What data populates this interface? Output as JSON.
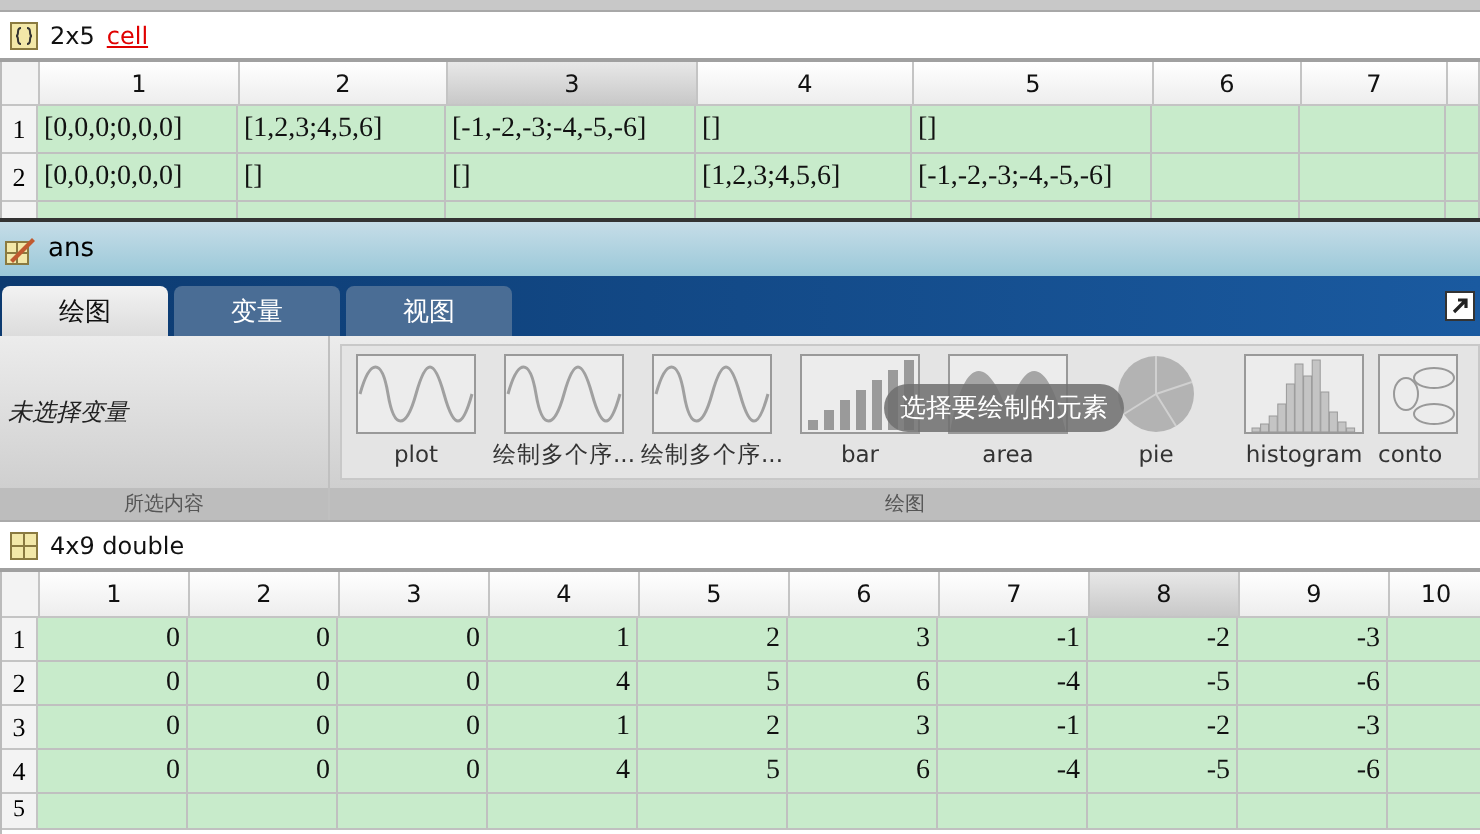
{
  "cell_view": {
    "size": "2x5",
    "type": "cell",
    "columns": [
      {
        "label": "1",
        "selected": false
      },
      {
        "label": "2",
        "selected": false
      },
      {
        "label": "3",
        "selected": true
      },
      {
        "label": "4",
        "selected": false
      },
      {
        "label": "5",
        "selected": false
      },
      {
        "label": "6",
        "selected": false
      },
      {
        "label": "7",
        "selected": false
      }
    ],
    "rows": [
      {
        "label": "1",
        "cells": [
          "[0,0,0;0,0,0]",
          "[1,2,3;4,5,6]",
          "[-1,-2,-3;-4,-5,-6]",
          "[]",
          "[]"
        ]
      },
      {
        "label": "2",
        "cells": [
          "[0,0,0;0,0,0]",
          "[]",
          "[]",
          "[1,2,3;4,5,6]",
          "[-1,-2,-3;-4,-5,-6]"
        ]
      }
    ]
  },
  "variable_bar": {
    "title": "ans"
  },
  "tabs": [
    {
      "label": "绘图",
      "selected": true
    },
    {
      "label": "变量",
      "selected": false
    },
    {
      "label": "视图",
      "selected": false
    }
  ],
  "ribbon": {
    "selection_text": "未选择变量",
    "selection_label": "所选内容",
    "gallery_label": "绘图",
    "tooltip": "选择要绘制的元素",
    "gallery": [
      {
        "label": "plot",
        "kind": "line"
      },
      {
        "label": "绘制多个序...",
        "kind": "line"
      },
      {
        "label": "绘制多个序...",
        "kind": "line"
      },
      {
        "label": "bar",
        "kind": "bar"
      },
      {
        "label": "area",
        "kind": "area"
      },
      {
        "label": "pie",
        "kind": "pie"
      },
      {
        "label": "histogram",
        "kind": "histogram"
      },
      {
        "label": "conto",
        "kind": "contour"
      }
    ]
  },
  "matrix_view": {
    "title": "4x9 double",
    "columns": [
      {
        "label": "1",
        "selected": false
      },
      {
        "label": "2",
        "selected": false
      },
      {
        "label": "3",
        "selected": false
      },
      {
        "label": "4",
        "selected": false
      },
      {
        "label": "5",
        "selected": false
      },
      {
        "label": "6",
        "selected": false
      },
      {
        "label": "7",
        "selected": false
      },
      {
        "label": "8",
        "selected": true
      },
      {
        "label": "9",
        "selected": false
      },
      {
        "label": "10",
        "selected": false
      }
    ],
    "rows": [
      {
        "label": "1",
        "cells": [
          "0",
          "0",
          "0",
          "1",
          "2",
          "3",
          "-1",
          "-2",
          "-3"
        ]
      },
      {
        "label": "2",
        "cells": [
          "0",
          "0",
          "0",
          "4",
          "5",
          "6",
          "-4",
          "-5",
          "-6"
        ]
      },
      {
        "label": "3",
        "cells": [
          "0",
          "0",
          "0",
          "1",
          "2",
          "3",
          "-1",
          "-2",
          "-3"
        ]
      },
      {
        "label": "4",
        "cells": [
          "0",
          "0",
          "0",
          "4",
          "5",
          "6",
          "-4",
          "-5",
          "-6"
        ]
      },
      {
        "label": "5",
        "cells": []
      }
    ]
  }
}
